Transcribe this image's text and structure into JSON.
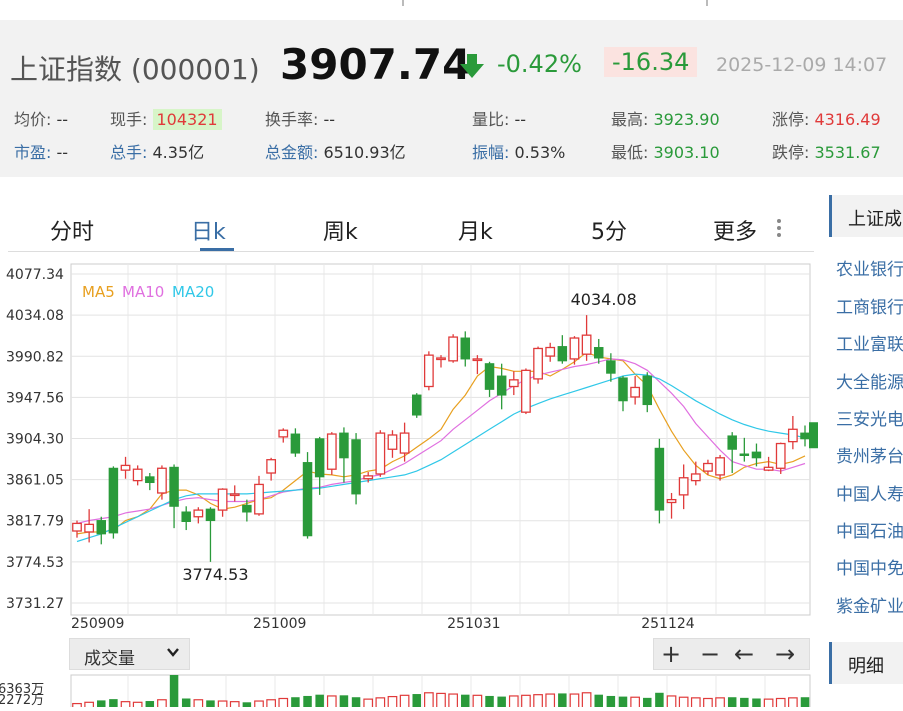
{
  "quote": {
    "name": "上证指数 (000001)",
    "price": "3907.74",
    "change_pct": "-0.42%",
    "change": "-16.34",
    "datetime": "2025-12-09 14:07",
    "colors": {
      "up": "#e03a3a",
      "down": "#2a9a3a",
      "link": "#3a6ea5"
    }
  },
  "stats": {
    "avg_label": "均价:",
    "avg_value": "--",
    "cur_hand_label": "现手:",
    "cur_hand_value": "104321",
    "turnover_label": "换手率:",
    "turnover_value": "--",
    "vol_ratio_label": "量比:",
    "vol_ratio_value": "--",
    "high_label": "最高:",
    "high_value": "3923.90",
    "limit_up_label": "涨停:",
    "limit_up_value": "4316.49",
    "pe_label": "市盈:",
    "pe_value": "--",
    "total_hand_label": "总手:",
    "total_hand_value": "4.35亿",
    "amount_label": "总金额:",
    "amount_value": "6510.93亿",
    "amplitude_label": "振幅:",
    "amplitude_value": "0.53%",
    "low_label": "最低:",
    "low_value": "3903.10",
    "limit_down_label": "跌停:",
    "limit_down_value": "3531.67"
  },
  "tabs": [
    "分时",
    "日k",
    "周k",
    "月k",
    "5分",
    "更多"
  ],
  "active_tab": "日k",
  "volume": {
    "dropdown_label": "成交量",
    "dropdown_icon": "chevron-down-icon",
    "axis_labels": [
      "6363万",
      "2272万"
    ]
  },
  "controls": [
    {
      "name": "zoom-in-button",
      "label": "+"
    },
    {
      "name": "zoom-out-button",
      "label": "−"
    },
    {
      "name": "pan-left-button",
      "label": "←"
    },
    {
      "name": "pan-right-button",
      "label": "→"
    }
  ],
  "sidebar": {
    "header": "上证成",
    "items": [
      "农业银行",
      "工商银行",
      "工业富联",
      "大全能源",
      "三安光电",
      "贵州茅台",
      "中国人寿",
      "中国石油",
      "中国中免",
      "紫金矿业"
    ],
    "footer_header": "明细"
  },
  "chart_data": {
    "type": "candlestick",
    "y_ticks": [
      "4077.34",
      "4034.08",
      "3990.82",
      "3947.56",
      "3904.30",
      "3861.05",
      "3817.79",
      "3774.53",
      "3731.27"
    ],
    "ylim": [
      3731.27,
      4077.34
    ],
    "x_tick_labels": [
      {
        "label": "250909",
        "index": 0
      },
      {
        "label": "251009",
        "index": 15
      },
      {
        "label": "251031",
        "index": 31
      },
      {
        "label": "251124",
        "index": 47
      }
    ],
    "legend": [
      {
        "name": "MA5",
        "color": "#e8a020"
      },
      {
        "name": "MA10",
        "color": "#e070e0"
      },
      {
        "name": "MA20",
        "color": "#30c8e8"
      }
    ],
    "annotations": [
      {
        "text": "4034.08",
        "value": 4034.08,
        "index": 42
      },
      {
        "text": "3774.53",
        "value": 3774.53,
        "index": 10
      }
    ],
    "candles": [
      [
        3807,
        3815,
        3800,
        3818
      ],
      [
        3806,
        3814,
        3795,
        3830
      ],
      [
        3818,
        3804,
        3793,
        3822
      ],
      [
        3873,
        3805,
        3799,
        3875
      ],
      [
        3871,
        3876,
        3862,
        3885
      ],
      [
        3860,
        3872,
        3855,
        3876
      ],
      [
        3864,
        3858,
        3850,
        3868
      ],
      [
        3847,
        3873,
        3840,
        3876
      ],
      [
        3874,
        3833,
        3810,
        3877
      ],
      [
        3827,
        3817,
        3808,
        3833
      ],
      [
        3822,
        3829,
        3815,
        3832
      ],
      [
        3830,
        3818,
        3774.53,
        3832
      ],
      [
        3829,
        3851,
        3822,
        3852
      ],
      [
        3846,
        3846,
        3838,
        3855
      ],
      [
        3834,
        3827,
        3817,
        3840
      ],
      [
        3825,
        3856,
        3823,
        3865
      ],
      [
        3868,
        3882,
        3860,
        3884
      ],
      [
        3906,
        3913,
        3900,
        3915
      ],
      [
        3909,
        3889,
        3885,
        3915
      ],
      [
        3879,
        3802,
        3799,
        3890
      ],
      [
        3904,
        3864,
        3845,
        3906
      ],
      [
        3872,
        3909,
        3866,
        3911
      ],
      [
        3910,
        3884,
        3858,
        3916
      ],
      [
        3903,
        3846,
        3835,
        3910
      ],
      [
        3862,
        3865,
        3858,
        3869
      ],
      [
        3867,
        3910,
        3864,
        3913
      ],
      [
        3893,
        3908,
        3884,
        3913
      ],
      [
        3889,
        3910,
        3880,
        3921
      ],
      [
        3950,
        3929,
        3926,
        3952
      ],
      [
        3959,
        3992,
        3955,
        3996
      ],
      [
        3988,
        3989,
        3979,
        3992
      ],
      [
        3986,
        4011,
        3984,
        4014
      ],
      [
        4010,
        3988,
        3980,
        4017
      ],
      [
        3988,
        3988,
        3972,
        3992
      ],
      [
        3983,
        3956,
        3948,
        3985
      ],
      [
        3970,
        3950,
        3935,
        3983
      ],
      [
        3959,
        3966,
        3950,
        3975
      ],
      [
        3932,
        3976,
        3930,
        3978
      ],
      [
        3967,
        3999,
        3962,
        4001
      ],
      [
        3991,
        4000,
        3985,
        4005
      ],
      [
        4001,
        3986,
        3983,
        4013
      ],
      [
        3988,
        4010,
        3982,
        4012
      ],
      [
        3993,
        4013,
        3986,
        4034.08
      ],
      [
        4000,
        3989,
        3983,
        4009
      ],
      [
        3986,
        3973,
        3964,
        3994
      ],
      [
        3968,
        3944,
        3933,
        3970
      ],
      [
        3948,
        3958,
        3940,
        3970
      ],
      [
        3970,
        3940,
        3932,
        3974
      ],
      [
        3894,
        3829,
        3815,
        3904
      ],
      [
        3837,
        3840,
        3820,
        3847
      ],
      [
        3845,
        3863,
        3830,
        3877
      ],
      [
        3860,
        3867,
        3855,
        3880
      ],
      [
        3870,
        3878,
        3866,
        3882
      ],
      [
        3866,
        3884,
        3860,
        3887
      ],
      [
        3907,
        3893,
        3868,
        3911
      ],
      [
        3888,
        3887,
        3880,
        3905
      ],
      [
        3890,
        3884,
        3875,
        3899
      ],
      [
        3871,
        3874,
        3870,
        3885
      ],
      [
        3873,
        3899,
        3867,
        3900
      ],
      [
        3901,
        3914,
        3893,
        3928
      ],
      [
        3910,
        3904,
        3896,
        3918
      ]
    ],
    "ma5": [
      3804,
      3806,
      3806,
      3808,
      3818,
      3822,
      3830,
      3846,
      3850,
      3850,
      3845,
      3836,
      3830,
      3832,
      3836,
      3840,
      3842,
      3850,
      3860,
      3870,
      3867,
      3866,
      3864,
      3866,
      3870,
      3872,
      3880,
      3886,
      3895,
      3904,
      3914,
      3935,
      3950,
      3970,
      3980,
      3978,
      3975,
      3975,
      3975,
      3970,
      3977,
      3985,
      3995,
      3990,
      3988,
      3986,
      3972,
      3960,
      3935,
      3912,
      3892,
      3876,
      3866,
      3862,
      3866,
      3874,
      3878,
      3880,
      3877,
      3880,
      3886
    ],
    "ma10": [
      3815,
      3818,
      3820,
      3822,
      3826,
      3828,
      3830,
      3834,
      3838,
      3841,
      3842,
      3840,
      3838,
      3838,
      3838,
      3840,
      3844,
      3848,
      3850,
      3852,
      3853,
      3856,
      3858,
      3860,
      3864,
      3866,
      3872,
      3878,
      3886,
      3894,
      3902,
      3914,
      3924,
      3934,
      3944,
      3952,
      3960,
      3966,
      3971,
      3974,
      3977,
      3980,
      3982,
      3985,
      3988,
      3987,
      3983,
      3976,
      3964,
      3952,
      3938,
      3920,
      3906,
      3892,
      3880,
      3876,
      3872,
      3872,
      3870,
      3874,
      3878
    ],
    "ma20": [
      3796,
      3800,
      3804,
      3810,
      3816,
      3822,
      3828,
      3834,
      3840,
      3844,
      3846,
      3846,
      3846,
      3846,
      3846,
      3847,
      3848,
      3849,
      3850,
      3851,
      3852,
      3854,
      3856,
      3858,
      3860,
      3862,
      3864,
      3866,
      3870,
      3876,
      3882,
      3890,
      3898,
      3906,
      3914,
      3922,
      3930,
      3936,
      3941,
      3946,
      3950,
      3954,
      3958,
      3962,
      3966,
      3970,
      3972,
      3971,
      3967,
      3960,
      3952,
      3944,
      3937,
      3930,
      3924,
      3919,
      3915,
      3912,
      3910,
      3908,
      3905
    ],
    "volume": [
      1800,
      2000,
      2300,
      2500,
      2100,
      2000,
      2200,
      2400,
      6300,
      2600,
      2400,
      2300,
      2200,
      2100,
      2000,
      2200,
      2400,
      2600,
      2800,
      3000,
      3200,
      3000,
      3100,
      2800,
      2500,
      2700,
      2900,
      3100,
      3300,
      3500,
      3400,
      3300,
      3200,
      3100,
      3000,
      2900,
      3000,
      3100,
      3200,
      3300,
      3400,
      3300,
      3500,
      3200,
      3000,
      2900,
      2800,
      2700,
      3500,
      3000,
      2800,
      2700,
      2600,
      2700,
      2800,
      2700,
      2600,
      2500,
      2600,
      2700,
      2800
    ]
  }
}
